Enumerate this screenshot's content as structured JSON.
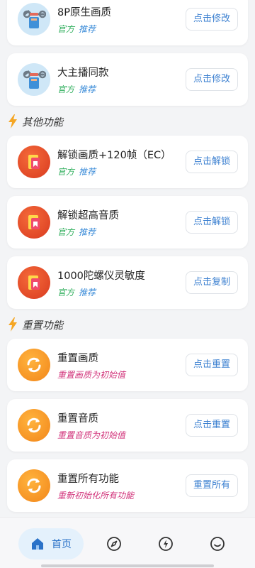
{
  "cards_top": [
    {
      "title": "8P原生画质",
      "tag_official": "官方",
      "tag_recommend": "推荐",
      "button": "点击修改",
      "icon": "wrench-icon"
    },
    {
      "title": "大主播同款",
      "tag_official": "官方",
      "tag_recommend": "推荐",
      "button": "点击修改",
      "icon": "wrench-icon"
    }
  ],
  "other_section": {
    "title": "其他功能",
    "items": [
      {
        "title": "解锁画质+120帧（EC）",
        "tag_official": "官方",
        "tag_recommend": "推荐",
        "button": "点击解锁",
        "icon": "unlock-app-icon"
      },
      {
        "title": "解锁超高音质",
        "tag_official": "官方",
        "tag_recommend": "推荐",
        "button": "点击解锁",
        "icon": "unlock-app-icon"
      },
      {
        "title": "1000陀螺仪灵敏度",
        "tag_official": "官方",
        "tag_recommend": "推荐",
        "button": "点击复制",
        "icon": "unlock-app-icon"
      }
    ]
  },
  "reset_section": {
    "title": "重置功能",
    "items": [
      {
        "title": "重置画质",
        "desc": "重置画质为初始值",
        "button": "点击重置",
        "icon": "refresh-icon"
      },
      {
        "title": "重置音质",
        "desc": "重置音质为初始值",
        "button": "点击重置",
        "icon": "refresh-icon"
      },
      {
        "title": "重置所有功能",
        "desc": "重新初始化所有功能",
        "button": "重置所有",
        "icon": "refresh-icon"
      }
    ]
  },
  "nav": {
    "home_label": "首页",
    "items": [
      "home-icon",
      "compass-icon",
      "lightning-icon",
      "smile-icon"
    ]
  },
  "colors": {
    "official": "#2fae5c",
    "recommend": "#3a8bd8",
    "reset_desc": "#d2367c",
    "button_text": "#3a7fd0",
    "nav_active_bg": "#e4f1fc"
  }
}
